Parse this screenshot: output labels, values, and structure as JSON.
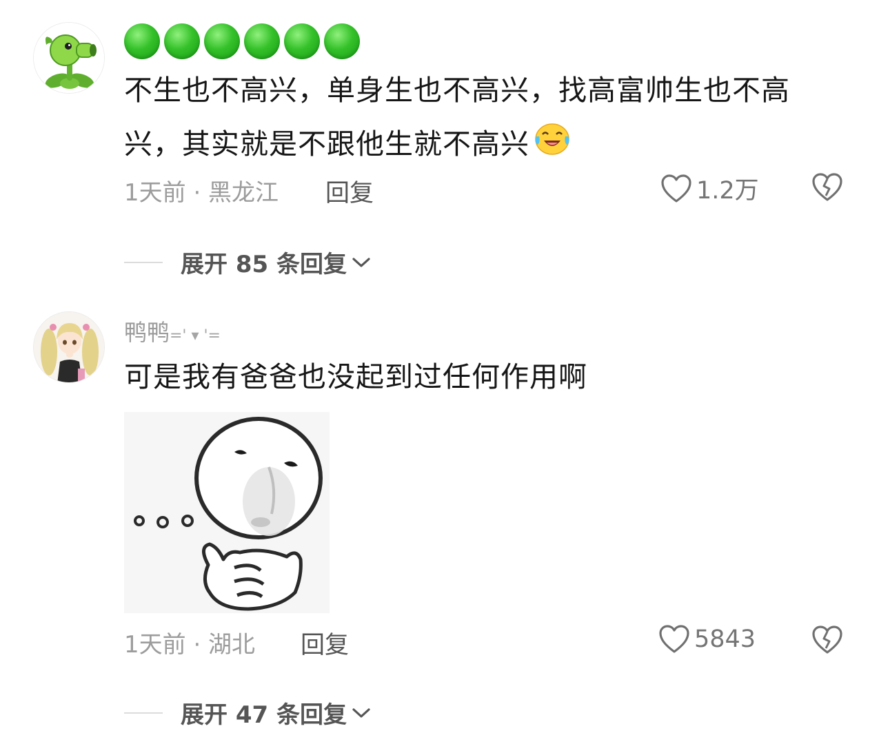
{
  "comments": [
    {
      "avatar_icon": "peashooter-avatar",
      "username_icon": "green-circle-emoji-row",
      "username_color": "#2dbb22",
      "text_line1": "不生也不高兴，单身生也不高兴，找高富帅生也不高",
      "text_line2": "兴，其实就是不跟他生就不高兴",
      "emoji_icon": "laughing-tears-emoji",
      "meta": "1天前 · 黑龙江",
      "reply_label": "回复",
      "likes": "1.2万",
      "expand_label": "展开 85 条回复"
    },
    {
      "avatar_icon": "anime-girl-avatar",
      "username": "鸭鸭",
      "username_suffix": "=' ▾ '=",
      "text": "可是我有爸爸也没起到过任何作用啊",
      "sticker_icon": "thinking-face-sticker",
      "meta": "1天前 · 湖北",
      "reply_label": "回复",
      "likes": "5843",
      "expand_label": "展开 47 条回复"
    }
  ]
}
